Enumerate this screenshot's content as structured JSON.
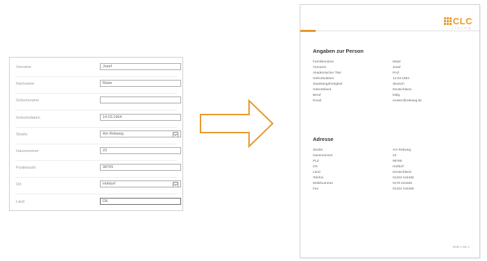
{
  "form": {
    "rows": [
      {
        "label": "Vorname",
        "value": "Josef",
        "dropdown": false
      },
      {
        "label": "Nachname",
        "value": "Maier",
        "dropdown": false
      },
      {
        "label": "Geburtsname",
        "value": "",
        "dropdown": false
      },
      {
        "label": "Geburtsdatum",
        "value": "14.03.1964",
        "dropdown": false
      },
      {
        "label": "Straße",
        "value": "Am Rebweg",
        "dropdown": true
      },
      {
        "label": "Hausnummer",
        "value": "23",
        "dropdown": false
      },
      {
        "label": "Postleitzahl",
        "value": "98765",
        "dropdown": false
      },
      {
        "label": "Ort",
        "value": "Hofdorf",
        "dropdown": true
      },
      {
        "label": "Land",
        "value": "DE",
        "dropdown": false
      }
    ]
  },
  "document": {
    "logo": {
      "name": "CLC",
      "subtitle": "living"
    },
    "person_section": {
      "title": "Angaben zur Person",
      "rows": [
        {
          "key": "Familienname",
          "value": "Maier"
        },
        {
          "key": "Vorname",
          "value": "Josef"
        },
        {
          "key": "Akademischer Titel",
          "value": "Prof."
        },
        {
          "key": "Geburtsdatum",
          "value": "14.03.1964"
        },
        {
          "key": "Staatsangehörigkeit",
          "value": "deutsch"
        },
        {
          "key": "Geburtsland",
          "value": "Deutschland"
        },
        {
          "key": "Beruf",
          "value": "ledig"
        },
        {
          "key": "Email",
          "value": "muster@rebweg.de"
        }
      ]
    },
    "address_section": {
      "title": "Adresse",
      "rows": [
        {
          "key": "Straße",
          "value": "Am Rebweg"
        },
        {
          "key": "Hausnummer",
          "value": "23"
        },
        {
          "key": "PLZ",
          "value": "98765"
        },
        {
          "key": "Ort",
          "value": "Hofdorf"
        },
        {
          "key": "Land",
          "value": "Deutschland"
        },
        {
          "key": "Telefon",
          "value": "01234 444455"
        },
        {
          "key": "Mobilnummer",
          "value": "0178 444455"
        },
        {
          "key": "Fax",
          "value": "01234 444456"
        }
      ]
    },
    "footer": "Seite 1 von 1"
  },
  "colors": {
    "accent": "#e8982a",
    "border": "#cfcfcf",
    "field_border": "#a9a9a9"
  },
  "icons": {
    "arrow": "right-arrow-icon",
    "dropdown": "dropdown-icon",
    "logo": "clc-logo-icon"
  }
}
